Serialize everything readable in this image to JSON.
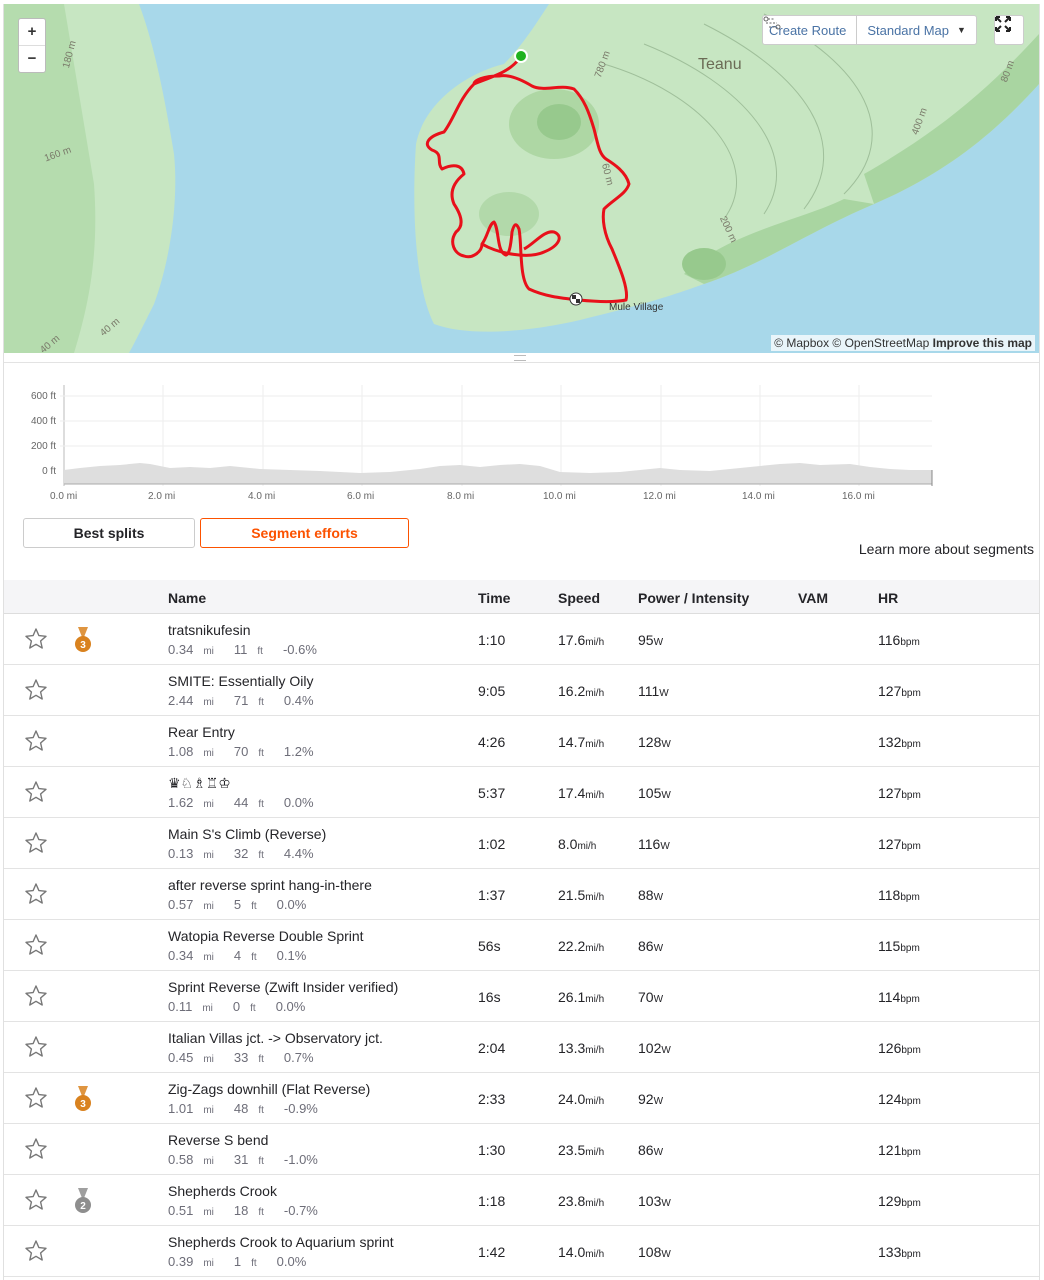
{
  "map": {
    "zoom_in": "+",
    "zoom_out": "−",
    "create_route": "Create Route",
    "map_type": "Standard Map",
    "attribution_1": "© Mapbox © OpenStreetMap",
    "attribution_2": "Improve this map",
    "place_label": "Teanu",
    "village_label": "Mule Village",
    "contours": [
      "180 m",
      "160 m",
      "40 m",
      "40 m",
      "780 m",
      "400 m",
      "200 m",
      "80 m",
      "60 m"
    ]
  },
  "elevation": {
    "y_ticks": [
      "600 ft",
      "400 ft",
      "200 ft",
      "0 ft"
    ],
    "x_ticks": [
      "0.0 mi",
      "2.0 mi",
      "4.0 mi",
      "6.0 mi",
      "8.0 mi",
      "10.0 mi",
      "12.0 mi",
      "14.0 mi",
      "16.0 mi"
    ]
  },
  "tabs": {
    "best_splits": "Best splits",
    "segment_efforts": "Segment efforts"
  },
  "learn_more": "Learn more about segments",
  "table": {
    "headers": {
      "name": "Name",
      "time": "Time",
      "speed": "Speed",
      "power": "Power / Intensity",
      "vam": "VAM",
      "hr": "HR"
    },
    "units": {
      "dist": "mi",
      "elev": "ft",
      "speed": "mi/h",
      "power": "W",
      "hr": "bpm"
    },
    "rows": [
      {
        "name": "tratsnikufesin",
        "dist": "0.34",
        "elev": "11",
        "grade": "-0.6%",
        "time": "1:10",
        "speed": "17.6",
        "power": "95",
        "hr": "116",
        "medal": "3"
      },
      {
        "name": "SMITE: Essentially Oily",
        "dist": "2.44",
        "elev": "71",
        "grade": "0.4%",
        "time": "9:05",
        "speed": "16.2",
        "power": "111",
        "hr": "127",
        "medal": ""
      },
      {
        "name": "Rear Entry",
        "dist": "1.08",
        "elev": "70",
        "grade": "1.2%",
        "time": "4:26",
        "speed": "14.7",
        "power": "128",
        "hr": "132",
        "medal": ""
      },
      {
        "name": "♛♘♗♖♔",
        "dist": "1.62",
        "elev": "44",
        "grade": "0.0%",
        "time": "5:37",
        "speed": "17.4",
        "power": "105",
        "hr": "127",
        "medal": ""
      },
      {
        "name": "Main S's Climb (Reverse)",
        "dist": "0.13",
        "elev": "32",
        "grade": "4.4%",
        "time": "1:02",
        "speed": "8.0",
        "power": "116",
        "hr": "127",
        "medal": ""
      },
      {
        "name": "after reverse sprint hang-in-there",
        "dist": "0.57",
        "elev": "5",
        "grade": "0.0%",
        "time": "1:37",
        "speed": "21.5",
        "power": "88",
        "hr": "118",
        "medal": ""
      },
      {
        "name": "Watopia Reverse Double Sprint",
        "dist": "0.34",
        "elev": "4",
        "grade": "0.1%",
        "time": "56s",
        "speed": "22.2",
        "power": "86",
        "hr": "115",
        "medal": ""
      },
      {
        "name": "Sprint Reverse (Zwift Insider verified)",
        "dist": "0.11",
        "elev": "0",
        "grade": "0.0%",
        "time": "16s",
        "speed": "26.1",
        "power": "70",
        "hr": "114",
        "medal": ""
      },
      {
        "name": "Italian Villas jct. -> Observatory jct.",
        "dist": "0.45",
        "elev": "33",
        "grade": "0.7%",
        "time": "2:04",
        "speed": "13.3",
        "power": "102",
        "hr": "126",
        "medal": ""
      },
      {
        "name": "Zig-Zags downhill (Flat Reverse)",
        "dist": "1.01",
        "elev": "48",
        "grade": "-0.9%",
        "time": "2:33",
        "speed": "24.0",
        "power": "92",
        "hr": "124",
        "medal": "3"
      },
      {
        "name": "Reverse S bend",
        "dist": "0.58",
        "elev": "31",
        "grade": "-1.0%",
        "time": "1:30",
        "speed": "23.5",
        "power": "86",
        "hr": "121",
        "medal": ""
      },
      {
        "name": "Shepherds Crook",
        "dist": "0.51",
        "elev": "18",
        "grade": "-0.7%",
        "time": "1:18",
        "speed": "23.8",
        "power": "103",
        "hr": "129",
        "medal": "2"
      },
      {
        "name": "Shepherds Crook to Aquarium sprint",
        "dist": "0.39",
        "elev": "1",
        "grade": "0.0%",
        "time": "1:42",
        "speed": "14.0",
        "power": "108",
        "hr": "133",
        "medal": ""
      }
    ]
  },
  "colors": {
    "accent": "#fc5200",
    "route": "#e8101a",
    "bronze": "#d9821f",
    "silver": "#8e8e8e"
  }
}
